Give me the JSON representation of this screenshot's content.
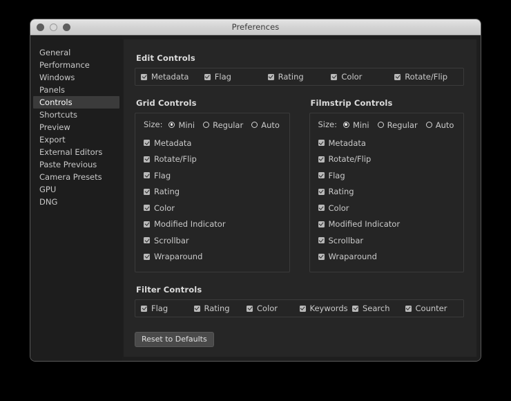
{
  "window": {
    "title": "Preferences",
    "traffic_lights": [
      "close-button",
      "minimize-button",
      "zoom-button"
    ]
  },
  "sidebar": {
    "items": [
      {
        "label": "General",
        "selected": false
      },
      {
        "label": "Performance",
        "selected": false
      },
      {
        "label": "Windows",
        "selected": false
      },
      {
        "label": "Panels",
        "selected": false
      },
      {
        "label": "Controls",
        "selected": true
      },
      {
        "label": "Shortcuts",
        "selected": false
      },
      {
        "label": "Preview",
        "selected": false
      },
      {
        "label": "Export",
        "selected": false
      },
      {
        "label": "External Editors",
        "selected": false
      },
      {
        "label": "Paste Previous",
        "selected": false
      },
      {
        "label": "Camera Presets",
        "selected": false
      },
      {
        "label": "GPU",
        "selected": false
      },
      {
        "label": "DNG",
        "selected": false
      }
    ]
  },
  "edit_controls": {
    "title": "Edit Controls",
    "checkboxes": [
      {
        "label": "Metadata",
        "checked": true
      },
      {
        "label": "Flag",
        "checked": true
      },
      {
        "label": "Rating",
        "checked": true
      },
      {
        "label": "Color",
        "checked": true
      },
      {
        "label": "Rotate/Flip",
        "checked": true
      }
    ]
  },
  "grid_controls": {
    "title": "Grid Controls",
    "size_label": "Size:",
    "size_options": [
      {
        "label": "Mini",
        "selected": true
      },
      {
        "label": "Regular",
        "selected": false
      },
      {
        "label": "Auto",
        "selected": false
      }
    ],
    "checkboxes": [
      {
        "label": "Metadata",
        "checked": true
      },
      {
        "label": "Rotate/Flip",
        "checked": true
      },
      {
        "label": "Flag",
        "checked": true
      },
      {
        "label": "Rating",
        "checked": true
      },
      {
        "label": "Color",
        "checked": true
      },
      {
        "label": "Modified Indicator",
        "checked": true
      },
      {
        "label": "Scrollbar",
        "checked": true
      },
      {
        "label": "Wraparound",
        "checked": true
      }
    ]
  },
  "filmstrip_controls": {
    "title": "Filmstrip Controls",
    "size_label": "Size:",
    "size_options": [
      {
        "label": "Mini",
        "selected": true
      },
      {
        "label": "Regular",
        "selected": false
      },
      {
        "label": "Auto",
        "selected": false
      }
    ],
    "checkboxes": [
      {
        "label": "Metadata",
        "checked": true
      },
      {
        "label": "Rotate/Flip",
        "checked": true
      },
      {
        "label": "Flag",
        "checked": true
      },
      {
        "label": "Rating",
        "checked": true
      },
      {
        "label": "Color",
        "checked": true
      },
      {
        "label": "Modified Indicator",
        "checked": true
      },
      {
        "label": "Scrollbar",
        "checked": true
      },
      {
        "label": "Wraparound",
        "checked": true
      }
    ]
  },
  "filter_controls": {
    "title": "Filter Controls",
    "checkboxes": [
      {
        "label": "Flag",
        "checked": true
      },
      {
        "label": "Rating",
        "checked": true
      },
      {
        "label": "Color",
        "checked": true
      },
      {
        "label": "Keywords",
        "checked": true
      },
      {
        "label": "Search",
        "checked": true
      },
      {
        "label": "Counter",
        "checked": true
      }
    ]
  },
  "footer": {
    "reset_label": "Reset to Defaults"
  },
  "colors": {
    "window_bg": "#232323",
    "sidebar_bg": "#1d1d1d",
    "content_bg": "#262626",
    "selection_bg": "#3b3b3b",
    "text": "#cacaca",
    "heading": "#dcdcdc",
    "box_border": "#3b3b3b",
    "button_bg": "#4a4a4a"
  }
}
